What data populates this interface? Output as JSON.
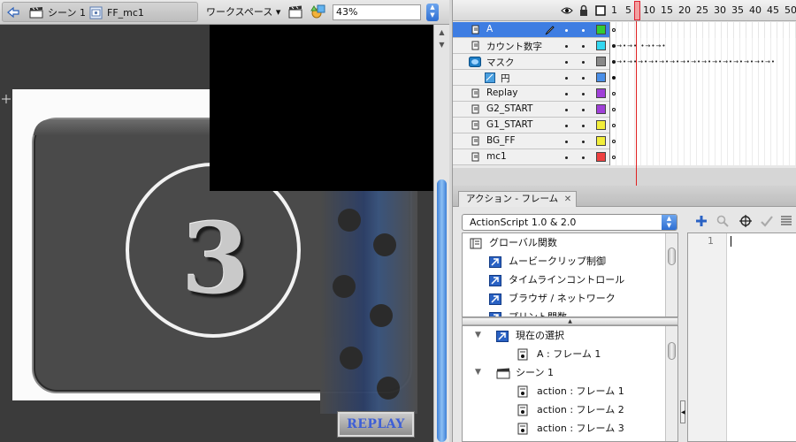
{
  "edit_bar": {
    "scene_label": "シーン 1",
    "symbol_label": "FF_mc1",
    "workspace_label": "ワークスペース ▾",
    "zoom_value": "43%"
  },
  "stage": {
    "countdown_digit": "3",
    "replay_label": "REPLAY"
  },
  "timeline": {
    "frame_numbers": [
      "1",
      "5",
      "10",
      "15",
      "20",
      "25",
      "30",
      "35",
      "40",
      "45",
      "50"
    ],
    "current_frame": 7,
    "layers": [
      {
        "name": "A",
        "type": "normal",
        "selected": true,
        "color": "#33cc33"
      },
      {
        "name": "カウント数字",
        "type": "normal",
        "selected": false,
        "color": "#33d7f0"
      },
      {
        "name": "マスク",
        "type": "mask",
        "selected": false,
        "color": "#888888"
      },
      {
        "name": "円",
        "type": "masked",
        "selected": false,
        "color": "#4a8fe8"
      },
      {
        "name": "Replay",
        "type": "normal",
        "selected": false,
        "color": "#a040d8"
      },
      {
        "name": "G2_START",
        "type": "normal",
        "selected": false,
        "color": "#a040d8"
      },
      {
        "name": "G1_START",
        "type": "normal",
        "selected": false,
        "color": "#f2ee3a"
      },
      {
        "name": "BG_FF",
        "type": "normal",
        "selected": false,
        "color": "#f2ee3a"
      },
      {
        "name": "mc1",
        "type": "normal",
        "selected": false,
        "color": "#ee4040"
      }
    ]
  },
  "actions_panel": {
    "tab_label": "アクション - フレーム",
    "version_select": "ActionScript 1.0 & 2.0",
    "toolbox_items": [
      {
        "label": "グローバル関数",
        "icon": "book-icon"
      },
      {
        "label": "ムービークリップ制御",
        "icon": "action-arrow-icon"
      },
      {
        "label": "タイムラインコントロール",
        "icon": "action-arrow-icon"
      },
      {
        "label": "ブラウザ / ネットワーク",
        "icon": "action-arrow-icon"
      },
      {
        "label": "プリント関数",
        "icon": "action-arrow-icon"
      }
    ],
    "navigator_items": [
      {
        "label": "現在の選択",
        "icon": "action-arrow-icon",
        "indent": 1
      },
      {
        "label": "A : フレーム 1",
        "icon": "script-frame-icon",
        "indent": 2
      },
      {
        "label": "シーン 1",
        "icon": "scene-icon",
        "indent": 1
      },
      {
        "label": "action : フレーム 1",
        "icon": "script-frame-icon",
        "indent": 2
      },
      {
        "label": "action : フレーム 2",
        "icon": "script-frame-icon",
        "indent": 2
      },
      {
        "label": "action : フレーム 3",
        "icon": "script-frame-icon",
        "indent": 2
      }
    ],
    "editor_line_number": "1"
  },
  "colors": {
    "selection_blue": "#3e7de2",
    "playhead_red": "#e02020",
    "stage_dark": "#3b3b3b"
  }
}
